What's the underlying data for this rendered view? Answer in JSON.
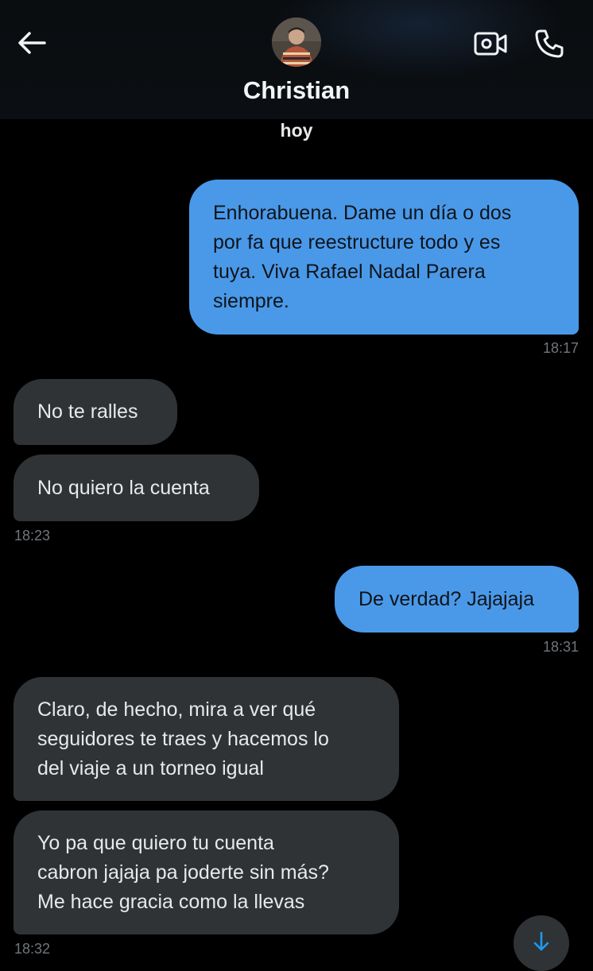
{
  "header": {
    "contact_name": "Christian",
    "back_icon": "arrow-left-icon",
    "video_icon": "video-camera-icon",
    "call_icon": "phone-icon"
  },
  "date_separator": "hoy",
  "messages": [
    {
      "direction": "sent",
      "lines": [
        "Enhorabuena. Dame un día o dos",
        "por fa que reestructure todo y es",
        "tuya. Viva Rafael Nadal Parera",
        "siempre."
      ],
      "time": "18:17"
    },
    {
      "direction": "received",
      "lines": [
        "No te ralles"
      ]
    },
    {
      "direction": "received",
      "lines": [
        "No quiero la cuenta"
      ],
      "time": "18:23"
    },
    {
      "direction": "sent",
      "lines": [
        "De verdad? Jajajaja"
      ],
      "time": "18:31"
    },
    {
      "direction": "received",
      "lines": [
        "Claro, de hecho, mira a ver qué",
        "seguidores te traes y hacemos lo",
        "del viaje a un torneo igual"
      ]
    },
    {
      "direction": "received",
      "lines": [
        "Yo pa que quiero tu cuenta",
        "cabron jajaja pa joderte sin más?",
        "Me hace gracia como la llevas"
      ],
      "time": "18:32"
    }
  ],
  "scroll_button_icon": "arrow-down-icon",
  "colors": {
    "background": "#000000",
    "sent_bubble": "#4a99e9",
    "received_bubble": "#2f3336",
    "timestamp": "#71767b"
  }
}
